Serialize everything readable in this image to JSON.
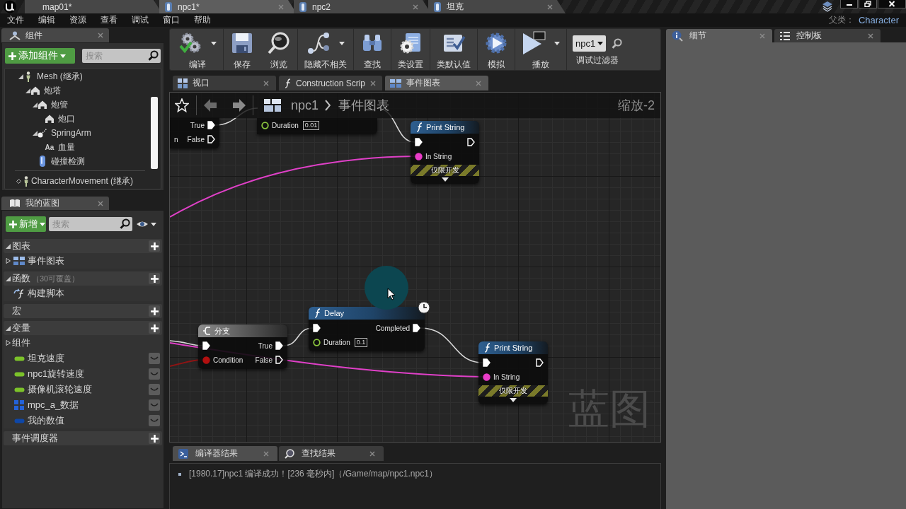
{
  "title_bar": {
    "tabs": [
      {
        "kind": "level",
        "label": "map01*",
        "selected": false
      },
      {
        "kind": "blueprint",
        "label": "npc1*",
        "selected": true
      },
      {
        "kind": "blueprint",
        "label": "npc2",
        "selected": false
      },
      {
        "kind": "blueprint",
        "label": "坦克",
        "selected": false
      }
    ]
  },
  "menu_bar": {
    "items": [
      "文件",
      "编辑",
      "资源",
      "查看",
      "调试",
      "窗口",
      "帮助"
    ],
    "parent_class": {
      "label": "父类：",
      "value": "Character"
    }
  },
  "components_panel": {
    "tab": "组件",
    "add_button": "添加组件",
    "search": {
      "placeholder": "搜索"
    },
    "tree": [
      {
        "kind": "skeletal",
        "label": "Mesh (继承)",
        "expanded": true,
        "children": [
          {
            "kind": "mesh",
            "label": "炮塔",
            "expanded": true,
            "children": [
              {
                "kind": "mesh",
                "label": "炮管",
                "expanded": true,
                "children": [
                  {
                    "kind": "mesh",
                    "label": "炮口"
                  }
                ]
              },
              {
                "kind": "spring",
                "label": "SpringArm",
                "expanded": true,
                "children": [
                  {
                    "kind": "text",
                    "badge": "Aa",
                    "label": "血量"
                  }
                ]
              },
              {
                "kind": "capsule",
                "label": "碰撞检测"
              }
            ]
          }
        ]
      }
    ],
    "movement": "CharacterMovement (继承)"
  },
  "my_blueprint": {
    "tab": "我的蓝图",
    "add_button": "新增",
    "search": {
      "placeholder": "搜索"
    },
    "sections": [
      {
        "title": "图表",
        "expanded": true,
        "items": [
          {
            "kind": "graph",
            "label": "事件图表",
            "expanded": false
          }
        ]
      },
      {
        "title": "函数",
        "note": "（30可覆盖）",
        "expanded": true,
        "items": [
          {
            "kind": "function",
            "label": "构建脚本"
          }
        ]
      },
      {
        "title": "宏",
        "expanded": false
      },
      {
        "title": "变量",
        "expanded": true,
        "items": [
          {
            "kind": "category",
            "label": "组件",
            "expanded": false
          },
          {
            "kind": "variable",
            "label": "坦克速度",
            "color": "#7cc22a"
          },
          {
            "kind": "variable",
            "label": "npc1旋转速度",
            "color": "#7cc22a"
          },
          {
            "kind": "variable",
            "label": "摄像机滚轮速度",
            "color": "#7cc22a"
          },
          {
            "kind": "struct",
            "label": "mpc_a_数据",
            "color": "#2462d8"
          },
          {
            "kind": "variable",
            "label": "我的数值",
            "color": "#0e47a8"
          }
        ]
      },
      {
        "title": "事件调度器",
        "expanded": false
      }
    ]
  },
  "toolbar": {
    "buttons": [
      {
        "label": "编译",
        "menu": true
      },
      {
        "label": "保存",
        "menu": false
      },
      {
        "label": "浏览",
        "menu": false
      },
      {
        "label": "隐藏不相关",
        "menu": true
      },
      {
        "label": "查找",
        "menu": false
      },
      {
        "label": "类设置",
        "menu": false
      },
      {
        "label": "类默认值",
        "menu": false
      },
      {
        "label": "模拟",
        "menu": false
      },
      {
        "label": "播放",
        "menu": true
      }
    ],
    "debug_filter": {
      "value": "npc1",
      "label": "调试过滤器"
    }
  },
  "editor_tabs": [
    {
      "label": "视口",
      "selected": false
    },
    {
      "label": "Construction Scrip",
      "selected": false
    },
    {
      "label": "事件图表",
      "selected": true
    }
  ],
  "graph": {
    "breadcrumb": [
      "npc1",
      "事件图表"
    ],
    "zoom": "缩放-2",
    "watermark": "蓝图",
    "nodes": [
      {
        "kind": "branch",
        "rows": [
          {
            "out": {
              "kind": "exec",
              "label": "True",
              "connected": true
            }
          },
          {
            "in": {
              "label": "n"
            },
            "out": {
              "kind": "exec",
              "label": "False",
              "connected": false
            }
          }
        ]
      },
      {
        "kind": "delay",
        "rows": [
          {
            "in": {
              "kind": "float",
              "label": "Duration",
              "connected": false,
              "value": "0.01"
            }
          }
        ]
      },
      {
        "kind": "print",
        "title": "Print String",
        "rows": [
          {
            "in": {
              "kind": "exec",
              "connected": true
            },
            "out": {
              "kind": "exec",
              "connected": false
            }
          },
          {
            "in": {
              "kind": "string",
              "label": "In String",
              "connected": true
            }
          }
        ],
        "dev_only": "仅限开发",
        "expanded": false
      },
      {
        "kind": "branch",
        "title": "分支",
        "rows": [
          {
            "in": {
              "kind": "exec",
              "connected": true
            },
            "out": {
              "kind": "exec",
              "label": "True",
              "connected": true
            }
          },
          {
            "in": {
              "kind": "bool",
              "label": "Condition",
              "connected": true
            },
            "out": {
              "kind": "exec",
              "label": "False",
              "connected": false
            }
          }
        ]
      },
      {
        "kind": "delay",
        "title": "Delay",
        "latent": true,
        "rows": [
          {
            "in": {
              "kind": "exec",
              "connected": true
            },
            "out": {
              "kind": "exec",
              "label": "Completed",
              "connected": true
            }
          },
          {
            "in": {
              "kind": "float",
              "label": "Duration",
              "connected": false,
              "value": "0.1"
            }
          }
        ]
      },
      {
        "kind": "print",
        "title": "Print String",
        "rows": [
          {
            "in": {
              "kind": "exec",
              "connected": true
            },
            "out": {
              "kind": "exec",
              "connected": false
            }
          },
          {
            "in": {
              "kind": "string",
              "label": "In String",
              "connected": true
            }
          }
        ],
        "dev_only": "仅限开发",
        "expanded": false
      }
    ]
  },
  "results_panel": {
    "tabs": [
      {
        "label": "编译器结果",
        "selected": true
      },
      {
        "label": "查找结果",
        "selected": false
      }
    ],
    "log": [
      "[1980.17]npc1 编译成功！[236 毫秒内]（/Game/map/npc1.npc1）"
    ]
  },
  "details_panel": {
    "tabs": [
      {
        "label": "细节",
        "selected": true
      },
      {
        "label": "控制板",
        "selected": false
      }
    ]
  }
}
